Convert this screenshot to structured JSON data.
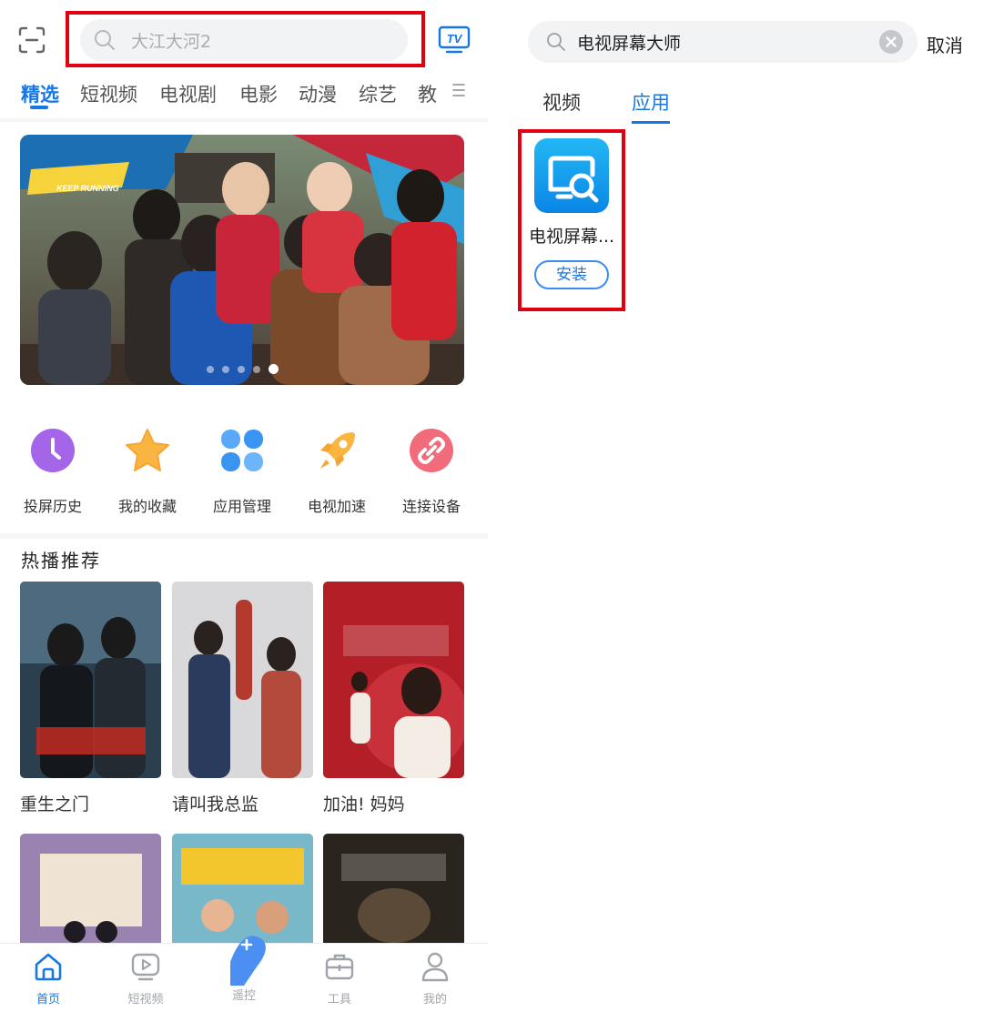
{
  "left": {
    "search_placeholder": "大江大河2",
    "tabs": [
      "精选",
      "短视频",
      "电视剧",
      "电影",
      "动漫",
      "综艺",
      "教"
    ],
    "quick_actions": [
      {
        "label": "投屏历史",
        "icon": "clock-icon",
        "color": "#b070ee"
      },
      {
        "label": "我的收藏",
        "icon": "star-icon",
        "color": "#f9b53f"
      },
      {
        "label": "应用管理",
        "icon": "apps-grid-icon",
        "color": "#4fa3f7"
      },
      {
        "label": "电视加速",
        "icon": "rocket-icon",
        "color": "#f9b53f"
      },
      {
        "label": "连接设备",
        "icon": "link-icon",
        "color": "#f26b7a"
      }
    ],
    "section_title": "热播推荐",
    "cards": [
      {
        "title": "重生之门"
      },
      {
        "title": "请叫我总监"
      },
      {
        "title": "加油! 妈妈"
      }
    ],
    "bottom_nav": [
      {
        "label": "首页",
        "icon": "home-icon"
      },
      {
        "label": "短视频",
        "icon": "play-icon"
      },
      {
        "label": "遥控",
        "icon": "remote-icon"
      },
      {
        "label": "工具",
        "icon": "toolbox-icon"
      },
      {
        "label": "我的",
        "icon": "user-icon"
      }
    ],
    "active_tab": "精选",
    "active_nav": "首页"
  },
  "right": {
    "search_value": "电视屏幕大师",
    "cancel_label": "取消",
    "tabs": [
      "视频",
      "应用"
    ],
    "active_tab": "应用",
    "app": {
      "name": "电视屏幕...",
      "install_label": "安装"
    }
  },
  "colors": {
    "accent": "#1677e6",
    "highlight_box": "#e1000f"
  }
}
